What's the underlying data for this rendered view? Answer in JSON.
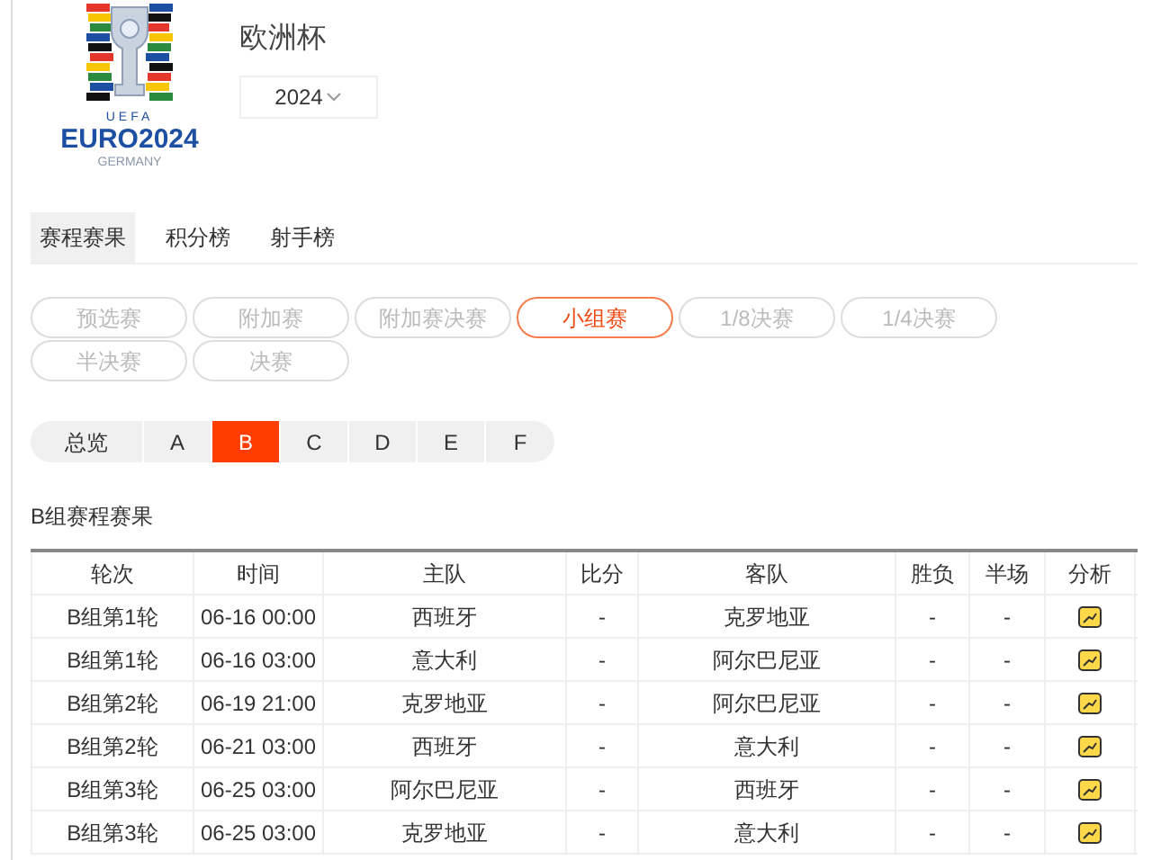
{
  "logo": {
    "org": "UEFA",
    "name": "EURO2024",
    "country": "GERMANY"
  },
  "title": "欧洲杯",
  "season": {
    "value": "2024"
  },
  "tabs": [
    {
      "label": "赛程赛果",
      "selected": true
    },
    {
      "label": "积分榜",
      "selected": false
    },
    {
      "label": "射手榜",
      "selected": false
    }
  ],
  "stages": [
    {
      "label": "预选赛",
      "selected": false
    },
    {
      "label": "附加赛",
      "selected": false
    },
    {
      "label": "附加赛决赛",
      "selected": false
    },
    {
      "label": "小组赛",
      "selected": true
    },
    {
      "label": "1/8决赛",
      "selected": false
    },
    {
      "label": "1/4决赛",
      "selected": false
    },
    {
      "label": "半决赛",
      "selected": false
    },
    {
      "label": "决赛",
      "selected": false
    }
  ],
  "groups": [
    {
      "label": "总览",
      "selected": false
    },
    {
      "label": "A",
      "selected": false
    },
    {
      "label": "B",
      "selected": true
    },
    {
      "label": "C",
      "selected": false
    },
    {
      "label": "D",
      "selected": false
    },
    {
      "label": "E",
      "selected": false
    },
    {
      "label": "F",
      "selected": false
    }
  ],
  "section_title": "B组赛程赛果",
  "table": {
    "columns": [
      "轮次",
      "时间",
      "主队",
      "比分",
      "客队",
      "胜负",
      "半场",
      "分析"
    ],
    "rows": [
      {
        "round": "B组第1轮",
        "time": "06-16 00:00",
        "home": "西班牙",
        "score": "-",
        "away": "克罗地亚",
        "result": "-",
        "half": "-"
      },
      {
        "round": "B组第1轮",
        "time": "06-16 03:00",
        "home": "意大利",
        "score": "-",
        "away": "阿尔巴尼亚",
        "result": "-",
        "half": "-"
      },
      {
        "round": "B组第2轮",
        "time": "06-19 21:00",
        "home": "克罗地亚",
        "score": "-",
        "away": "阿尔巴尼亚",
        "result": "-",
        "half": "-"
      },
      {
        "round": "B组第2轮",
        "time": "06-21 03:00",
        "home": "西班牙",
        "score": "-",
        "away": "意大利",
        "result": "-",
        "half": "-"
      },
      {
        "round": "B组第3轮",
        "time": "06-25 03:00",
        "home": "阿尔巴尼亚",
        "score": "-",
        "away": "西班牙",
        "result": "-",
        "half": "-"
      },
      {
        "round": "B组第3轮",
        "time": "06-25 03:00",
        "home": "克罗地亚",
        "score": "-",
        "away": "意大利",
        "result": "-",
        "half": "-"
      }
    ]
  }
}
